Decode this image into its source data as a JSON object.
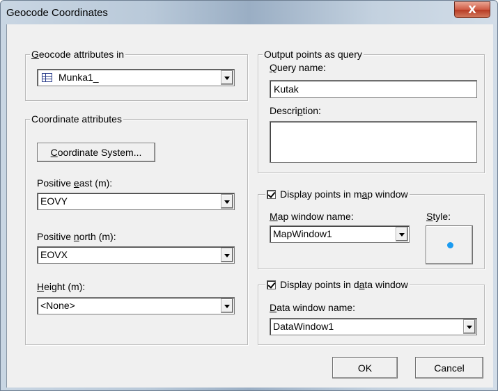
{
  "window": {
    "title": "Geocode Coordinates",
    "close_glyph": "X"
  },
  "geocode_group": {
    "title": "Geocode attributes in",
    "title_accel": "G",
    "title_rest": "eocode attributes in",
    "table_value": "Munka1_",
    "table_icon": "table-icon"
  },
  "coord_group": {
    "title": "Coordinate attributes",
    "coord_system_button": {
      "accel": "C",
      "rest": "oordinate System..."
    },
    "east": {
      "pre": "Positive ",
      "accel": "e",
      "post": "ast (m):",
      "value": "EOVY"
    },
    "north": {
      "pre": "Positive ",
      "accel": "n",
      "post": "orth (m):",
      "value": "EOVX"
    },
    "height": {
      "pre": "",
      "accel": "H",
      "post": "eight (m):",
      "value": "<None>"
    }
  },
  "output_group": {
    "title": "Output points as query",
    "query_name": {
      "accel": "Q",
      "rest": "uery name:",
      "value": "Kutak"
    },
    "description": {
      "pre": "Descri",
      "accel": "p",
      "post": "tion:",
      "value": ""
    }
  },
  "map_group": {
    "checkbox": {
      "pre": "Display points in m",
      "accel": "a",
      "post": "p window",
      "checked": true
    },
    "map_window_name": {
      "accel": "M",
      "rest": "ap window name:",
      "value": "MapWindow1"
    },
    "style": {
      "accel": "S",
      "rest": "tyle:",
      "dot_color": "#1b9bf0"
    }
  },
  "data_group": {
    "checkbox": {
      "pre": "Display points in d",
      "accel": "a",
      "post": "ta window",
      "checked": true
    },
    "data_window_name": {
      "accel": "D",
      "rest": "ata window name:",
      "value": "DataWindow1"
    }
  },
  "buttons": {
    "ok": "OK",
    "cancel": "Cancel"
  }
}
